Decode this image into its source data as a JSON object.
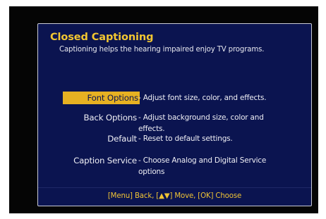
{
  "dialog": {
    "title": "Closed Captioning",
    "subtitle": "Captioning helps the hearing impaired enjoy TV programs."
  },
  "menu": {
    "items": [
      {
        "label": "Font Options",
        "description": "- Adjust font size, color, and effects.",
        "selected": true
      },
      {
        "label": "Back Options",
        "description": "- Adjust background size, color and effects.",
        "selected": false
      },
      {
        "label": "Default",
        "description": "- Reset to default settings.",
        "selected": false
      },
      {
        "label": "Caption Service",
        "description": "- Choose Analog and Digital Service options",
        "selected": false
      }
    ]
  },
  "footer": {
    "hint": "[Menu] Back, [▲▼] Move, [OK] Choose"
  },
  "colors": {
    "panel_background": "#0b1450",
    "accent_yellow": "#f2c631",
    "selection_highlight": "#e7b122",
    "text": "#eeeef4"
  }
}
